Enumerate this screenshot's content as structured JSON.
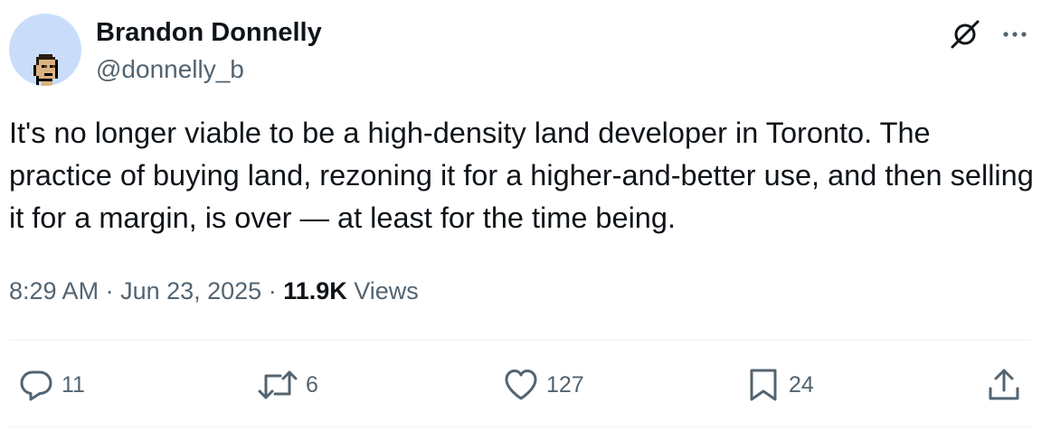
{
  "author": {
    "name": "Brandon Donnelly",
    "handle": "@donnelly_b"
  },
  "icons": {
    "avatar": "pixel-punk-avatar",
    "grok": "grok-icon",
    "more": "more-horizontal-icon"
  },
  "tweet": {
    "text": "It's no longer viable to be a high-density land developer in Toronto. The practice of buying land, rezoning it for a higher-and-better use, and then selling it for a margin, is over — at least for the time being."
  },
  "meta": {
    "time": "8:29 AM",
    "separator1": " · ",
    "date": "Jun 23, 2025",
    "separator2": " · ",
    "views_count": "11.9K",
    "views_label": " Views"
  },
  "actions": {
    "reply": {
      "icon": "reply-icon",
      "count": "11"
    },
    "repost": {
      "icon": "repost-icon",
      "count": "6"
    },
    "like": {
      "icon": "heart-icon",
      "count": "127"
    },
    "bookmark": {
      "icon": "bookmark-icon",
      "count": "24"
    },
    "share": {
      "icon": "share-icon"
    }
  },
  "colors": {
    "text_primary": "#0f1419",
    "text_secondary": "#536471",
    "divider": "#eff3f4",
    "avatar_bg": "#c9ddfb"
  }
}
